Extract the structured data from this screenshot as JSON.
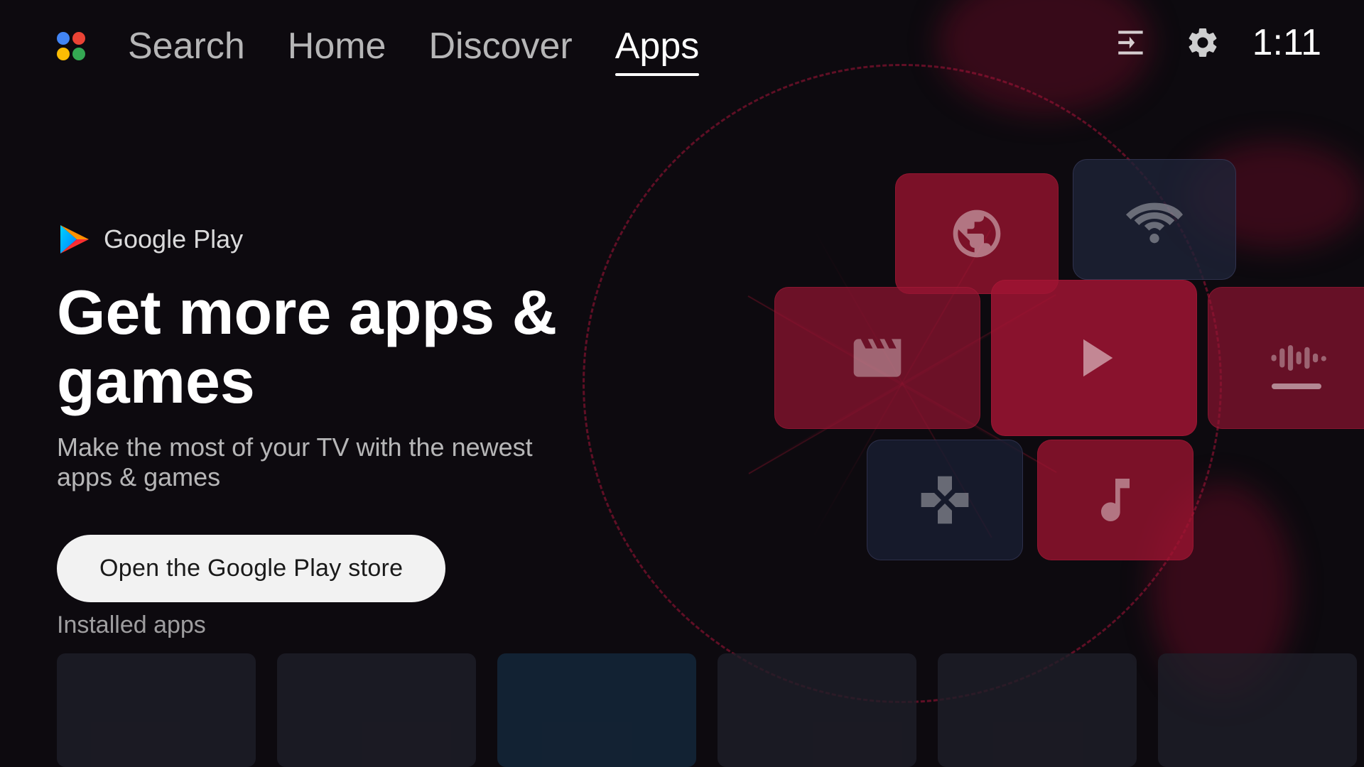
{
  "nav": {
    "items": [
      {
        "label": "Search",
        "active": false
      },
      {
        "label": "Home",
        "active": false
      },
      {
        "label": "Discover",
        "active": false
      },
      {
        "label": "Apps",
        "active": true
      }
    ]
  },
  "topRight": {
    "time": "1:11"
  },
  "hero": {
    "badge": "Google Play",
    "headline": "Get more apps & games",
    "subheadline": "Make the most of your TV with the newest apps & games",
    "ctaButton": "Open the Google Play store"
  },
  "installedApps": {
    "sectionTitle": "Installed apps"
  }
}
